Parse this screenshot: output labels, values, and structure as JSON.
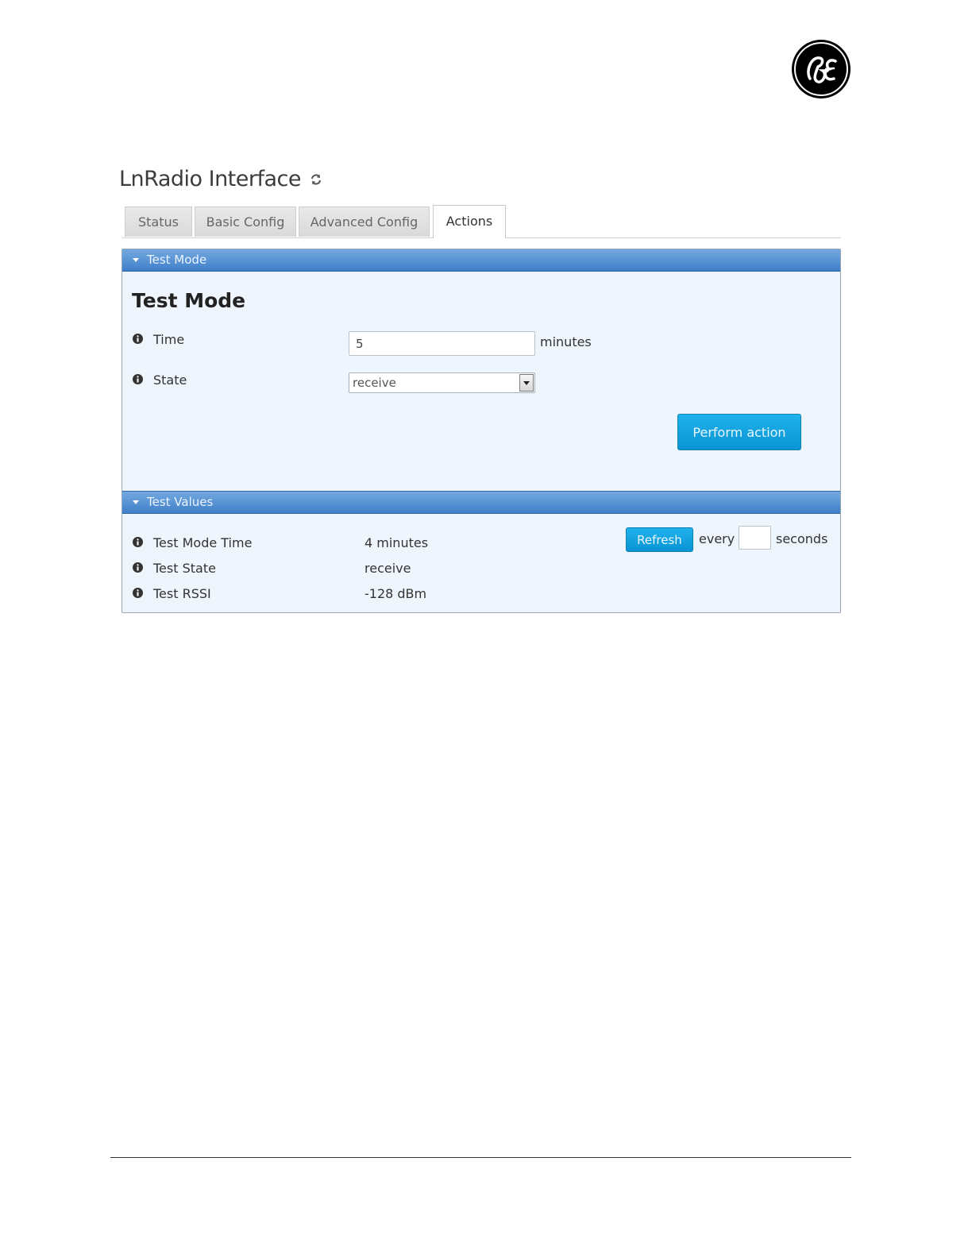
{
  "page": {
    "title": "LnRadio Interface"
  },
  "tabs": [
    {
      "label": "Status",
      "active": false
    },
    {
      "label": "Basic Config",
      "active": false
    },
    {
      "label": "Advanced Config",
      "active": false
    },
    {
      "label": "Actions",
      "active": true
    }
  ],
  "test_mode": {
    "section_label": "Test Mode",
    "heading": "Test Mode",
    "time": {
      "label": "Time",
      "value": "5",
      "unit": "minutes"
    },
    "state": {
      "label": "State",
      "selected": "receive"
    },
    "perform_label": "Perform action"
  },
  "test_values": {
    "section_label": "Test Values",
    "refresh_label": "Refresh",
    "every_label": "every",
    "interval_value": "",
    "seconds_label": "seconds",
    "rows": [
      {
        "label": "Test Mode Time",
        "value": "4 minutes"
      },
      {
        "label": "Test State",
        "value": "receive"
      },
      {
        "label": "Test RSSI",
        "value": "-128 dBm"
      }
    ]
  },
  "colors": {
    "section_bar": "#3f7fc8",
    "panel_bg": "#eef5fc",
    "primary_button": "#0a94d3"
  }
}
